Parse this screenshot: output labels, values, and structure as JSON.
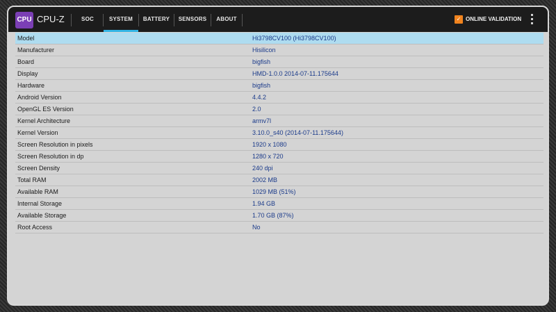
{
  "app": {
    "icon_text": "CPU Z",
    "title": "CPU-Z"
  },
  "tabs": [
    {
      "label": "SOC",
      "active": false
    },
    {
      "label": "SYSTEM",
      "active": true
    },
    {
      "label": "BATTERY",
      "active": false
    },
    {
      "label": "SENSORS",
      "active": false
    },
    {
      "label": "ABOUT",
      "active": false
    }
  ],
  "validation": {
    "label": "ONLINE VALIDATION"
  },
  "colors": {
    "accent": "#33b5e5",
    "highlight_row": "#aedcf0",
    "value_text": "#1a3a8a",
    "app_icon": "#7b3fb5",
    "validation_icon": "#f0831e"
  },
  "icons": [
    "cpu-z-app-icon",
    "online-validation-icon",
    "overflow-menu-icon"
  ],
  "rows": [
    {
      "label": "Model",
      "value": "Hi3798CV100 (Hi3798CV100)"
    },
    {
      "label": "Manufacturer",
      "value": "Hisilicon"
    },
    {
      "label": "Board",
      "value": "bigfish"
    },
    {
      "label": "Display",
      "value": "HMD-1.0.0 2014-07-11.175644"
    },
    {
      "label": "Hardware",
      "value": "bigfish"
    },
    {
      "label": "Android Version",
      "value": "4.4.2"
    },
    {
      "label": "OpenGL ES Version",
      "value": "2.0"
    },
    {
      "label": "Kernel Architecture",
      "value": "armv7l"
    },
    {
      "label": "Kernel Version",
      "value": "3.10.0_s40 (2014-07-11.175644)"
    },
    {
      "label": "Screen Resolution in pixels",
      "value": "1920 x 1080"
    },
    {
      "label": "Screen Resolution in dp",
      "value": "1280 x 720"
    },
    {
      "label": "Screen Density",
      "value": "240 dpi"
    },
    {
      "label": "Total RAM",
      "value": "2002 MB"
    },
    {
      "label": "Available RAM",
      "value": "1029 MB  (51%)"
    },
    {
      "label": "Internal Storage",
      "value": "1.94 GB"
    },
    {
      "label": "Available Storage",
      "value": "1.70 GB (87%)"
    },
    {
      "label": "Root Access",
      "value": "No"
    }
  ]
}
